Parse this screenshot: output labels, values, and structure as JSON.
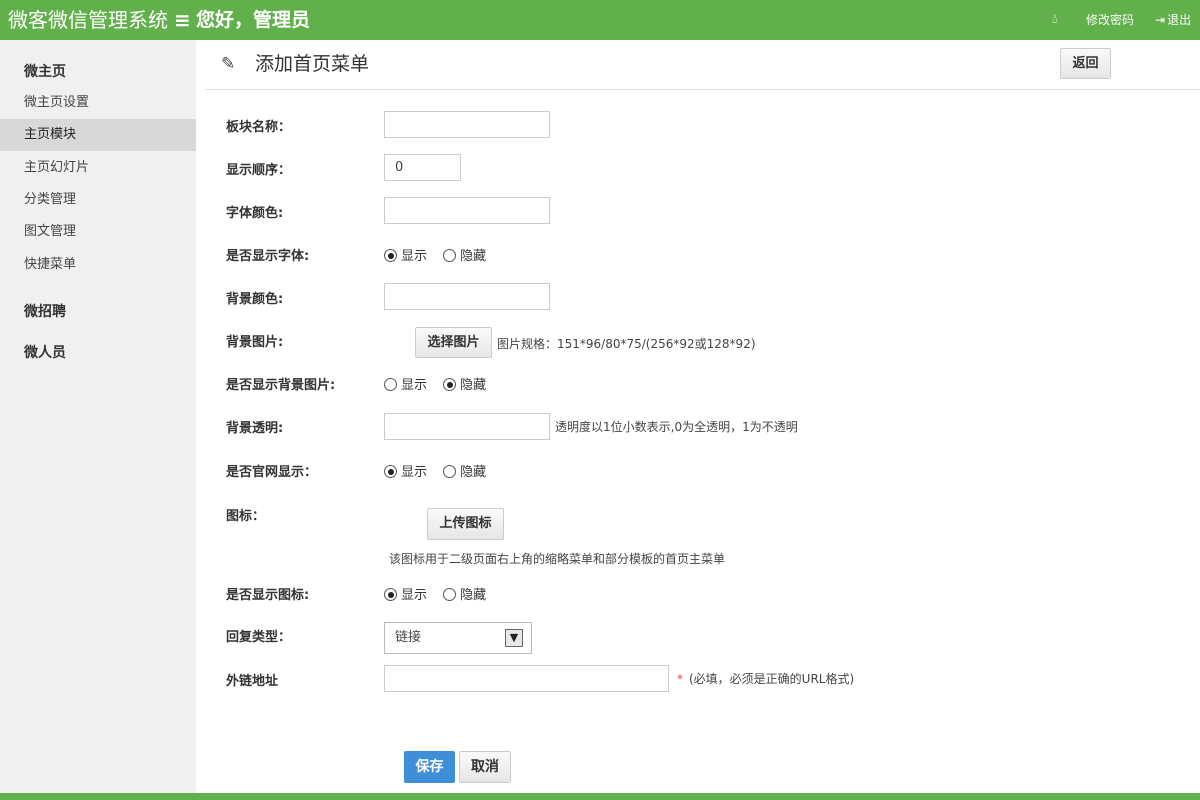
{
  "header": {
    "brand": "微客微信管理系统",
    "menu_icon": "≡",
    "greeting": "您好，管理员",
    "change_password": "修改密码",
    "logout": "退出"
  },
  "sidebar": {
    "sections": [
      {
        "title": "微主页"
      },
      {
        "title": "微招聘"
      },
      {
        "title": "微人员"
      }
    ],
    "items": [
      {
        "label": "微主页设置"
      },
      {
        "label": "主页模块"
      },
      {
        "label": "主页幻灯片"
      },
      {
        "label": "分类管理"
      },
      {
        "label": "图文管理"
      },
      {
        "label": "快捷菜单"
      }
    ],
    "active_index": 1
  },
  "page": {
    "title": "添加首页菜单",
    "back_label": "返回"
  },
  "form": {
    "block_name": {
      "label": "板块名称：",
      "value": ""
    },
    "display_order": {
      "label": "显示顺序：",
      "value": "0"
    },
    "font_color": {
      "label": "字体颜色:",
      "value": ""
    },
    "show_font": {
      "label": "是否显示字体:",
      "options": [
        "显示",
        "隐藏"
      ],
      "selected": "显示"
    },
    "bg_color": {
      "label": "背景颜色:",
      "value": ""
    },
    "bg_image": {
      "label": "背景图片:",
      "button": "选择图片",
      "hint": "图片规格：151*96/80*75/(256*92或128*92)"
    },
    "show_bg_image": {
      "label": "是否显示背景图片:",
      "options": [
        "显示",
        "隐藏"
      ],
      "selected": "隐藏"
    },
    "bg_opacity": {
      "label": "背景透明:",
      "value": "",
      "hint": "透明度以1位小数表示,0为全透明，1为不透明"
    },
    "show_official": {
      "label": "是否官网显示：",
      "options": [
        "显示",
        "隐藏"
      ],
      "selected": "显示"
    },
    "icon": {
      "label": "图标：",
      "button": "上传图标",
      "hint": "该图标用于二级页面右上角的缩略菜单和部分模板的首页主菜单"
    },
    "show_icon": {
      "label": "是否显示图标:",
      "options": [
        "显示",
        "隐藏"
      ],
      "selected": "显示"
    },
    "reply_type": {
      "label": "回复类型：",
      "value": "链接"
    },
    "external_url": {
      "label": "外链地址",
      "value": "",
      "required_mark": "*",
      "hint": "(必填，必须是正确的URL格式)"
    }
  },
  "actions": {
    "save": "保存",
    "cancel": "取消"
  },
  "colors": {
    "topbar": "#61b04b",
    "primary_button": "#3f8fd8",
    "sidebar_bg": "#f0f0f0",
    "sidebar_active": "#d8d8d8"
  }
}
